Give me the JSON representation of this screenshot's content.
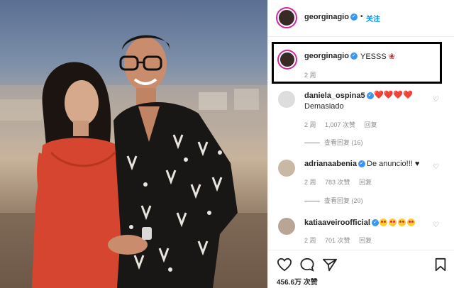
{
  "post": {
    "author": "georginagio",
    "follow_label": "关注",
    "separator": "•",
    "caption": {
      "username": "georginagio",
      "text": "YESSS",
      "time": "2 周"
    }
  },
  "comments": [
    {
      "username": "daniela_ospina5",
      "inline": "❤️❤️❤️❤️",
      "text": "Demasiado",
      "time": "2 周",
      "likes": "1,007 次赞",
      "reply": "回复",
      "view_replies": "查看回复 (16)"
    },
    {
      "username": "adrianaabenia",
      "text": "De anuncio!!! ♥",
      "time": "2 周",
      "likes": "783 次赞",
      "reply": "回复",
      "view_replies": "查看回复 (20)"
    },
    {
      "username": "katiaaveiroofficial",
      "time": "2 周",
      "likes": "701 次赞",
      "reply": "回复"
    }
  ],
  "footer": {
    "likes_count": "456.6万 次赞"
  },
  "colors": {
    "accent": "#0095f6",
    "verified": "#3897f0",
    "heart": "#ed1c3a",
    "caption_box": "#000000"
  },
  "icons": [
    "heart-icon",
    "comment-icon",
    "share-icon",
    "bookmark-icon",
    "verified-icon"
  ]
}
